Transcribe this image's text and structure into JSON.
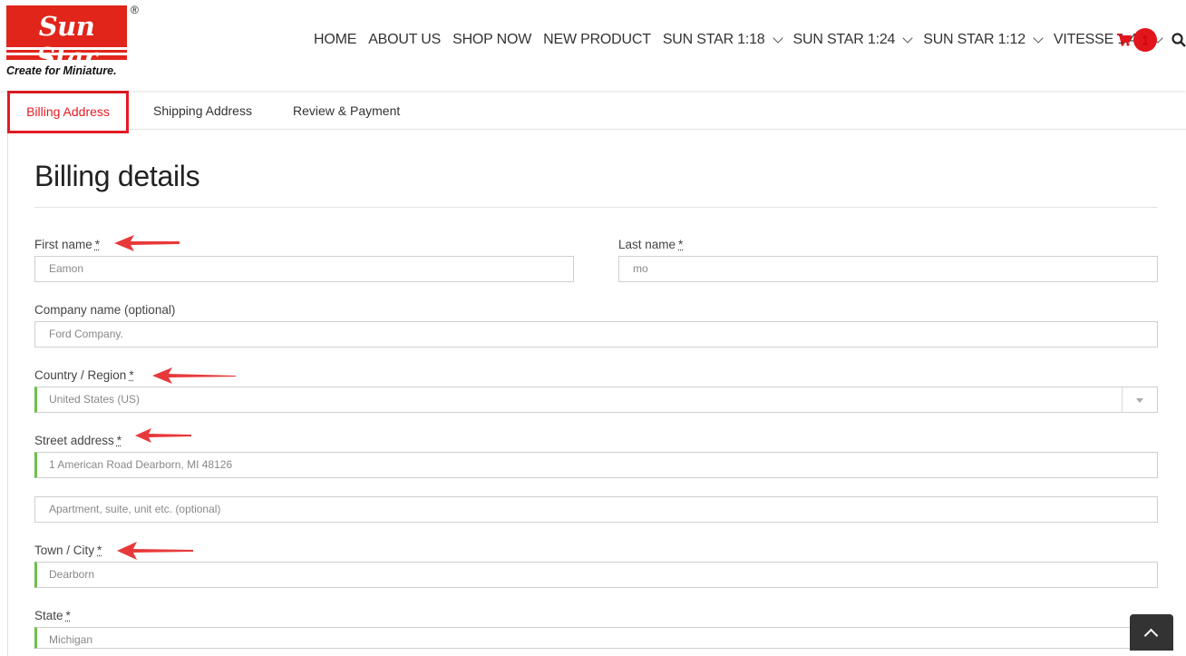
{
  "brand": {
    "name": "Sun Star",
    "tagline": "Create for Miniature.",
    "registered": "®"
  },
  "nav": {
    "items": [
      {
        "label": "HOME",
        "dropdown": false
      },
      {
        "label": "ABOUT US",
        "dropdown": false
      },
      {
        "label": "SHOP NOW",
        "dropdown": false
      },
      {
        "label": "NEW PRODUCT",
        "dropdown": false
      },
      {
        "label": "SUN STAR 1:18",
        "dropdown": true
      },
      {
        "label": "SUN STAR 1:24",
        "dropdown": true
      },
      {
        "label": "SUN STAR 1:12",
        "dropdown": true
      },
      {
        "label": "VITESSE 1:43",
        "dropdown": true
      }
    ],
    "cart_count": "1",
    "icons": {
      "cart": "cart-icon",
      "search": "search-icon"
    }
  },
  "tabs": [
    {
      "label": "Billing Address",
      "active": true
    },
    {
      "label": "Shipping Address",
      "active": false
    },
    {
      "label": "Review & Payment",
      "active": false
    }
  ],
  "form": {
    "heading": "Billing details",
    "required_mark": "*",
    "first_name": {
      "label": "First name",
      "value": "Eamon"
    },
    "last_name": {
      "label": "Last name",
      "value": "mo"
    },
    "company": {
      "label": "Company name (optional)",
      "value": "Ford Company."
    },
    "country": {
      "label": "Country / Region",
      "value": "United States (US)"
    },
    "street": {
      "label": "Street address",
      "value": "1 American Road Dearborn, MI 48126",
      "placeholder2": "Apartment, suite, unit etc. (optional)"
    },
    "city": {
      "label": "Town / City",
      "value": "Dearborn"
    },
    "state": {
      "label": "State",
      "value": "Michigan"
    }
  },
  "colors": {
    "accent": "#e31c23",
    "valid": "#6dc04a",
    "arrow": "#e8393a"
  }
}
